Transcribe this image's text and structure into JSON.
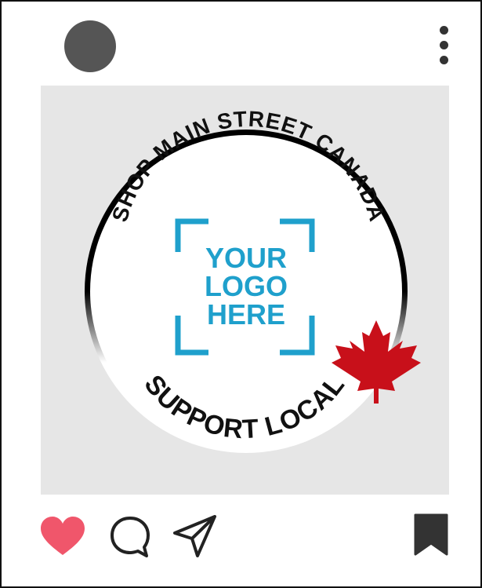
{
  "post": {
    "badge": {
      "top_arc_text": "SHOP MAIN STREET CANADA",
      "bottom_arc_text": "SUPPORT LOCAL",
      "logo_lines": [
        "YOUR",
        "LOGO",
        "HERE"
      ]
    }
  },
  "icons": {
    "avatar": "avatar",
    "more": "more-vertical-icon",
    "like": "heart-icon",
    "comment": "comment-bubble-icon",
    "share": "paper-plane-icon",
    "save": "bookmark-icon",
    "maple": "maple-leaf-icon"
  },
  "colors": {
    "like": "#f0566b",
    "logo": "#1fa0cc",
    "maple": "#c8101a",
    "post_bg": "#e6e6e6",
    "icon": "#333333"
  }
}
